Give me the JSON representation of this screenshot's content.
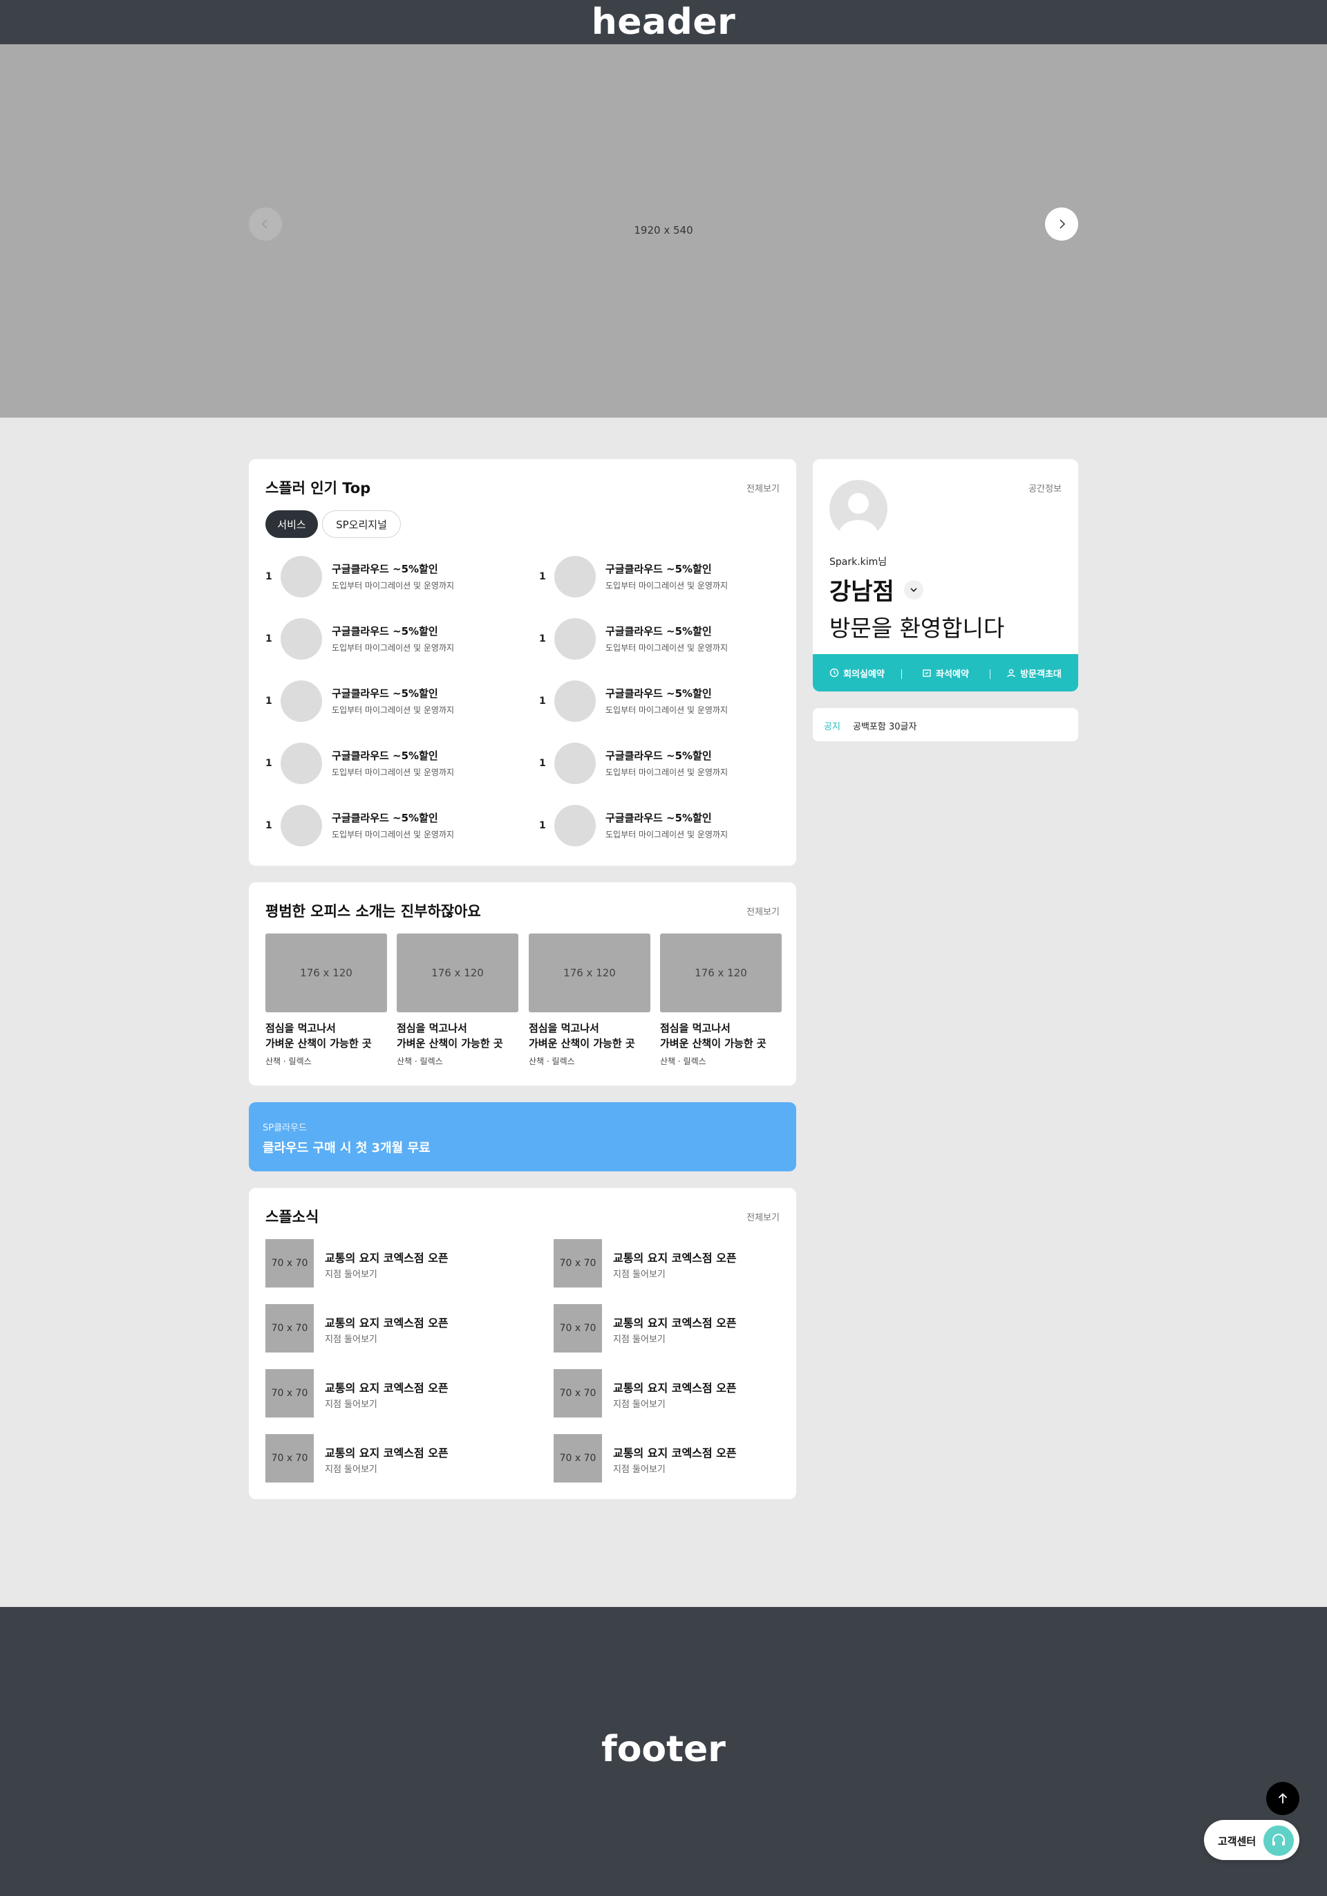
{
  "header": {
    "title": "header"
  },
  "hero": {
    "size_label": "1920 x 540"
  },
  "popular": {
    "title": "스플러 인기 Top",
    "more": "전체보기",
    "tabs": [
      {
        "label": "서비스",
        "active": true
      },
      {
        "label": "SP오리지널",
        "active": false
      }
    ],
    "items": [
      {
        "rank": "1",
        "title": "구글클라우드 ~5%할인",
        "desc": "도입부터 마이그레이션 및 운영까지"
      },
      {
        "rank": "1",
        "title": "구글클라우드 ~5%할인",
        "desc": "도입부터 마이그레이션 및 운영까지"
      },
      {
        "rank": "1",
        "title": "구글클라우드 ~5%할인",
        "desc": "도입부터 마이그레이션 및 운영까지"
      },
      {
        "rank": "1",
        "title": "구글클라우드 ~5%할인",
        "desc": "도입부터 마이그레이션 및 운영까지"
      },
      {
        "rank": "1",
        "title": "구글클라우드 ~5%할인",
        "desc": "도입부터 마이그레이션 및 운영까지"
      },
      {
        "rank": "1",
        "title": "구글클라우드 ~5%할인",
        "desc": "도입부터 마이그레이션 및 운영까지"
      },
      {
        "rank": "1",
        "title": "구글클라우드 ~5%할인",
        "desc": "도입부터 마이그레이션 및 운영까지"
      },
      {
        "rank": "1",
        "title": "구글클라우드 ~5%할인",
        "desc": "도입부터 마이그레이션 및 운영까지"
      },
      {
        "rank": "1",
        "title": "구글클라우드 ~5%할인",
        "desc": "도입부터 마이그레이션 및 운영까지"
      },
      {
        "rank": "1",
        "title": "구글클라우드 ~5%할인",
        "desc": "도입부터 마이그레이션 및 운영까지"
      }
    ]
  },
  "office": {
    "title": "평범한 오피스 소개는 진부하잖아요",
    "more": "전체보기",
    "items": [
      {
        "image_label": "176 x 120",
        "line1": "점심을 먹고나서",
        "line2": "가벼운 산책이 가능한 곳",
        "tags": "산책 · 릴렉스"
      },
      {
        "image_label": "176 x 120",
        "line1": "점심을 먹고나서",
        "line2": "가벼운 산책이 가능한 곳",
        "tags": "산책 · 릴렉스"
      },
      {
        "image_label": "176 x 120",
        "line1": "점심을 먹고나서",
        "line2": "가벼운 산책이 가능한 곳",
        "tags": "산책 · 릴렉스"
      },
      {
        "image_label": "176 x 120",
        "line1": "점심을 먹고나서",
        "line2": "가벼운 산책이 가능한 곳",
        "tags": "산책 · 릴렉스"
      }
    ]
  },
  "banner": {
    "small": "SP클라우드",
    "big": "클라우드 구매 시 첫 3개월 무료"
  },
  "news": {
    "title": "스플소식",
    "more": "전체보기",
    "items": [
      {
        "image_label": "70 x 70",
        "title": "교통의 요지 코엑스점 오픈",
        "sub": "지점 둘어보기"
      },
      {
        "image_label": "70 x 70",
        "title": "교통의 요지 코엑스점 오픈",
        "sub": "지점 둘어보기"
      },
      {
        "image_label": "70 x 70",
        "title": "교통의 요지 코엑스점 오픈",
        "sub": "지점 둘어보기"
      },
      {
        "image_label": "70 x 70",
        "title": "교통의 요지 코엑스점 오픈",
        "sub": "지점 둘어보기"
      },
      {
        "image_label": "70 x 70",
        "title": "교통의 요지 코엑스점 오픈",
        "sub": "지점 둘어보기"
      },
      {
        "image_label": "70 x 70",
        "title": "교통의 요지 코엑스점 오픈",
        "sub": "지점 둘어보기"
      },
      {
        "image_label": "70 x 70",
        "title": "교통의 요지 코엑스점 오픈",
        "sub": "지점 둘어보기"
      },
      {
        "image_label": "70 x 70",
        "title": "교통의 요지 코엑스점 오픈",
        "sub": "지점 둘어보기"
      }
    ]
  },
  "profile": {
    "space_info": "공간정보",
    "user_name": "Spark.kim님",
    "branch": "강남점",
    "welcome": "방문을 환영합니다",
    "actions": [
      {
        "label": "회의실예약",
        "icon": "clock-icon"
      },
      {
        "label": "좌석예약",
        "icon": "calendar-icon"
      },
      {
        "label": "방문객초대",
        "icon": "person-icon"
      }
    ],
    "accent": "#22bfc1"
  },
  "notice": {
    "tag": "공지",
    "text": "공백포함 30글자"
  },
  "footer": {
    "title": "footer"
  },
  "customer_center": {
    "label": "고객센터"
  }
}
